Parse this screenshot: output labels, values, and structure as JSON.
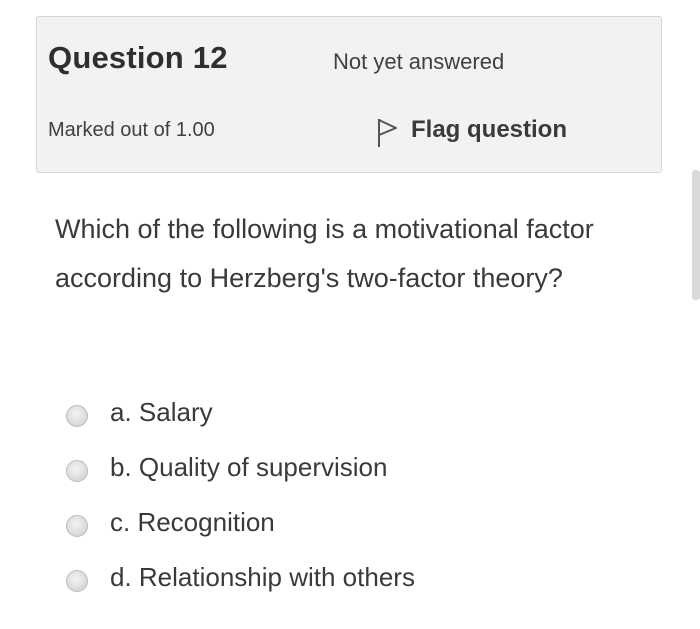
{
  "question_info": {
    "title": "Question 12",
    "state": "Not yet answered",
    "grade": "Marked out of 1.00",
    "flag_label": "Flag question"
  },
  "question": {
    "text": "Which of the following is a motivational factor according to Herzberg's two-factor theory?"
  },
  "answers": [
    {
      "label": "a. Salary",
      "selected": false
    },
    {
      "label": "b. Quality of supervision",
      "selected": false
    },
    {
      "label": "c. Recognition",
      "selected": false
    },
    {
      "label": "d. Relationship with others",
      "selected": false
    }
  ],
  "colors": {
    "info_background": "#f2f2f2",
    "info_border": "#d6d6d6",
    "text": "#3a3a3a",
    "radio": "#dcdcdc"
  },
  "icons": {
    "flag": "flag-outline-icon"
  }
}
